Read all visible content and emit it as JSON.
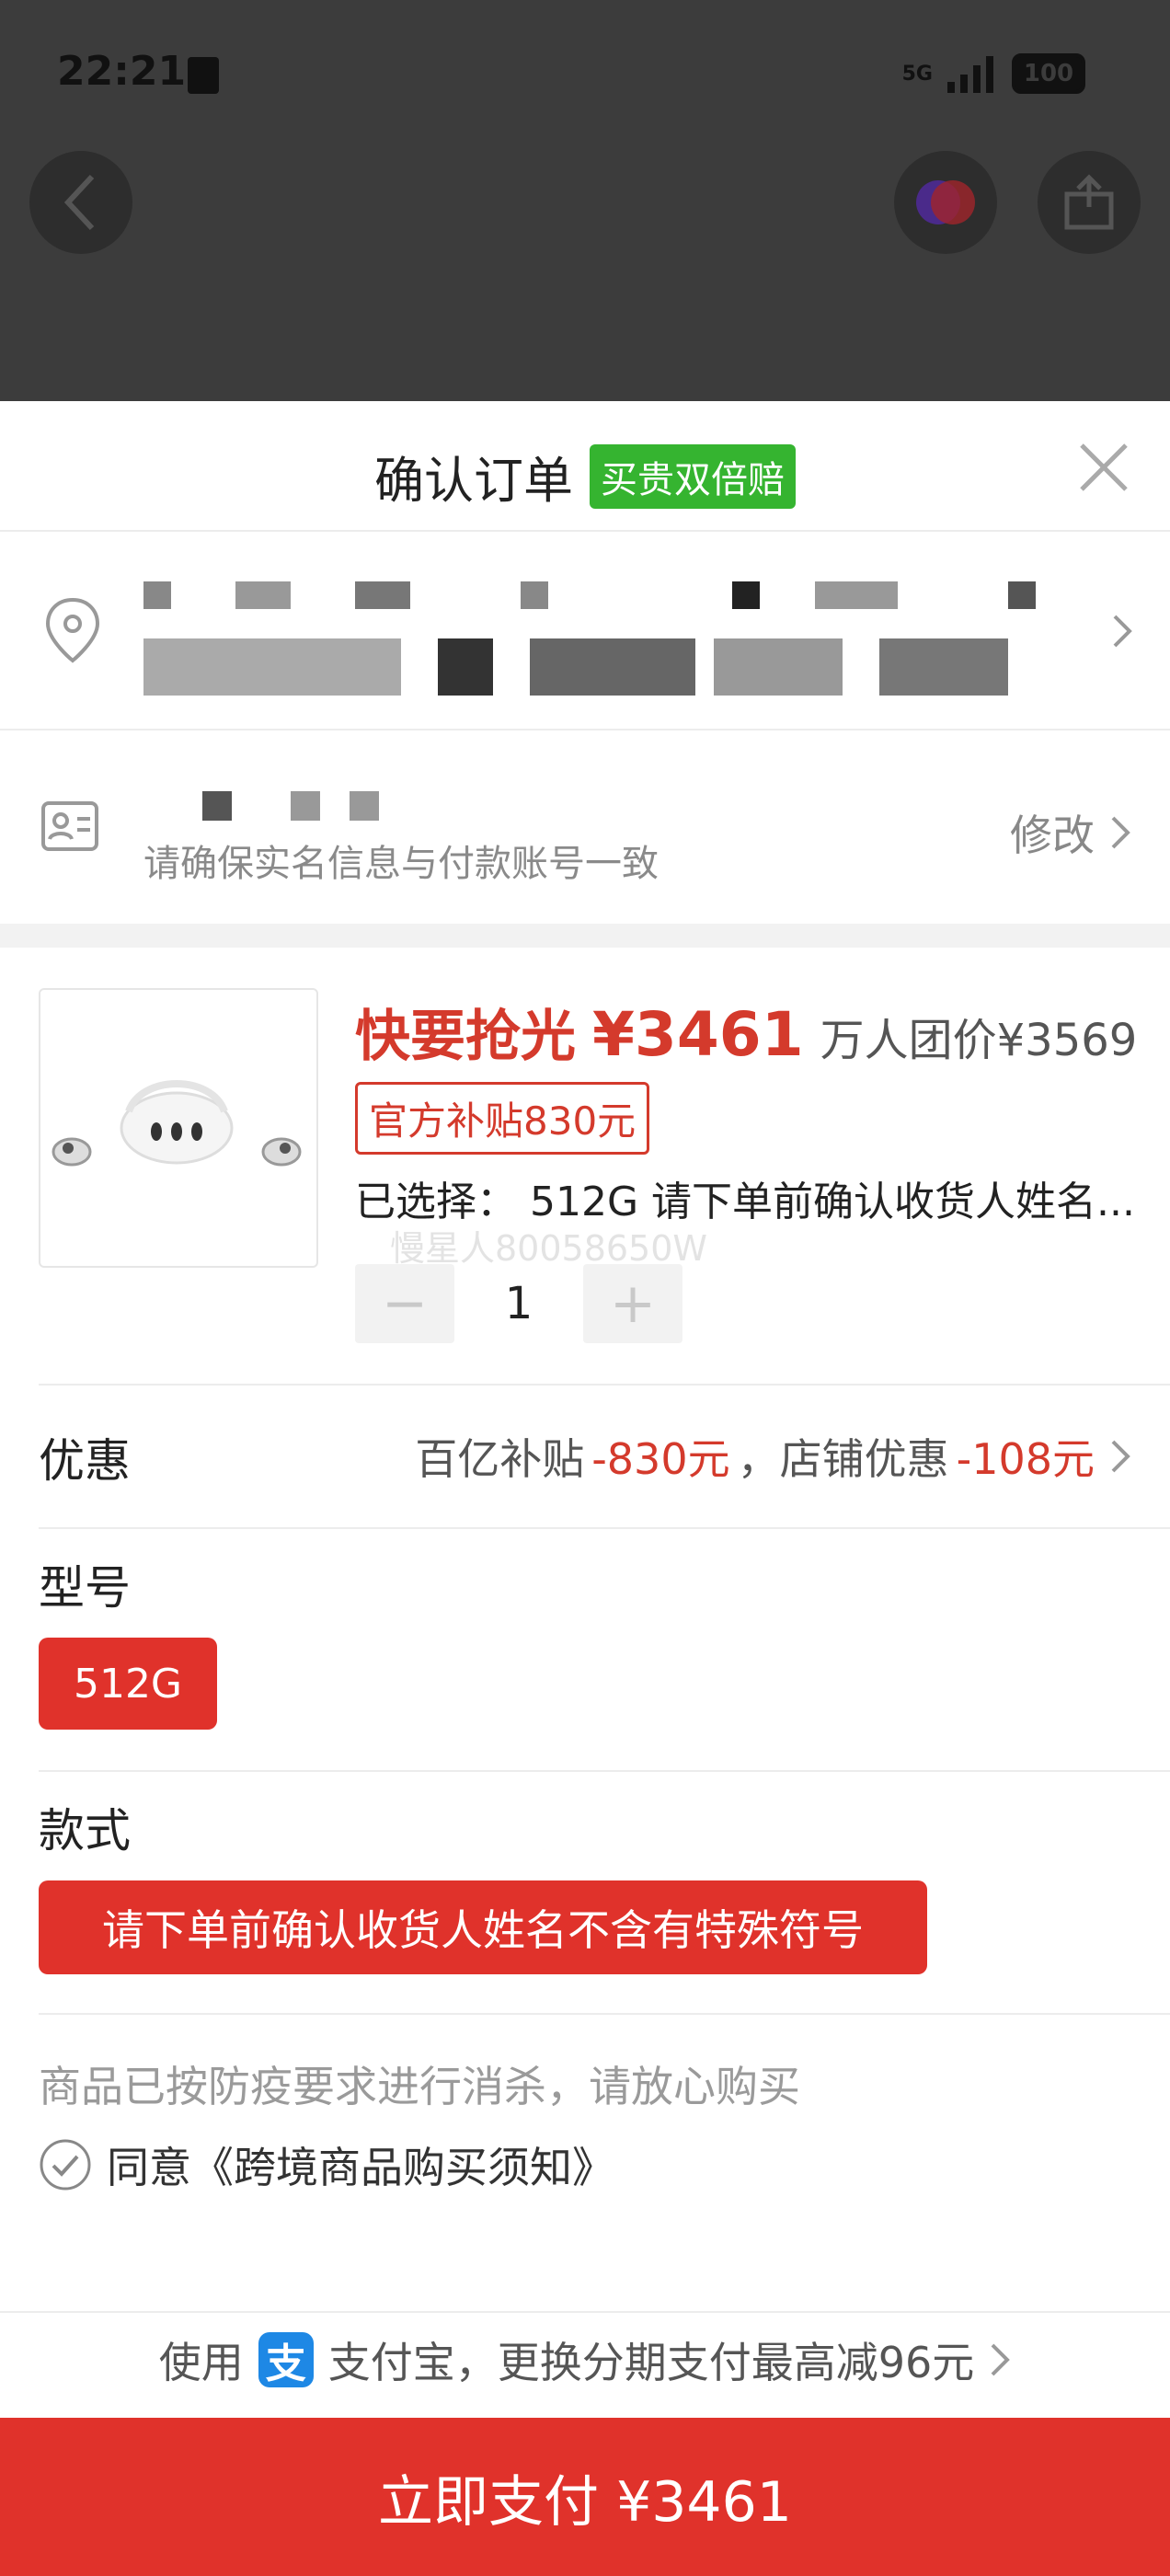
{
  "status_bar": {
    "time": "22:21",
    "network": "5G",
    "battery": "100"
  },
  "order": {
    "title": "确认订单",
    "badge": "买贵双倍赔",
    "identity_hint": "请确保实名信息与付款账号一致",
    "edit_label": "修改"
  },
  "product": {
    "hurry_label": "快要抢光",
    "price": "¥3461",
    "group_price": "万人团价¥3569",
    "subsidy_tag": "官方补贴830元",
    "selected_text": "已选择： 512G 请下单前确认收货人姓名...",
    "watermark": "慢星人80058650W",
    "quantity": "1",
    "minus_label": "−",
    "plus_label": "+"
  },
  "discount": {
    "label": "优惠",
    "subsidy_prefix": "百亿补贴",
    "subsidy_amount": "-830元",
    "separator": "，店铺优惠",
    "shop_amount": "-108元"
  },
  "model": {
    "label": "型号",
    "option": "512G"
  },
  "style": {
    "label": "款式",
    "option": "请下单前确认收货人姓名不含有特殊符号"
  },
  "notice": "商品已按防疫要求进行消杀，请放心购买",
  "agreement": "同意《跨境商品购买须知》",
  "alipay": {
    "prefix": "使用",
    "logo_glyph": "支",
    "text": "支付宝，更换分期支付最高减96元"
  },
  "pay_button": "立即支付 ¥3461",
  "colors": {
    "accent_red": "#e0322b",
    "price_red": "#d43a2c",
    "badge_green": "#35b430",
    "alipay_blue": "#1e88e5"
  }
}
